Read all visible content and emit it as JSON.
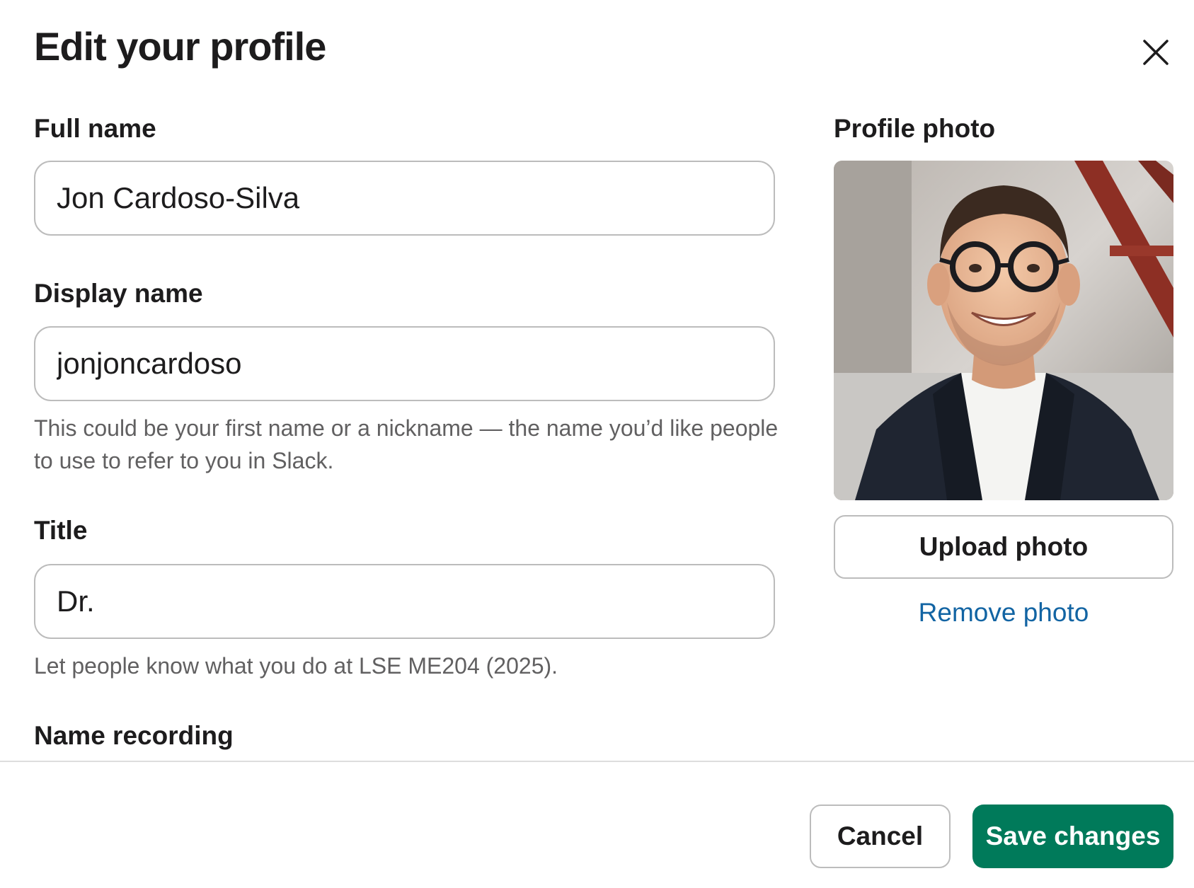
{
  "dialog": {
    "title": "Edit your profile",
    "close_icon": "close-icon"
  },
  "fields": {
    "full_name": {
      "label": "Full name",
      "value": "Jon Cardoso-Silva"
    },
    "display_name": {
      "label": "Display name",
      "value": "jonjoncardoso",
      "hint": "This could be your first name or a nickname — the name you’d like people to use to refer to you in Slack."
    },
    "title": {
      "label": "Title",
      "value": "Dr.",
      "hint": "Let people know what you do at LSE ME204 (2025)."
    },
    "name_recording": {
      "label": "Name recording"
    }
  },
  "profile_photo": {
    "label": "Profile photo",
    "upload_label": "Upload photo",
    "remove_label": "Remove photo"
  },
  "footer": {
    "cancel_label": "Cancel",
    "save_label": "Save changes"
  },
  "colors": {
    "primary": "#007a5a",
    "link": "#1264a3",
    "text": "#1d1c1d",
    "hint_text": "#616061",
    "border": "#bcbcbc"
  }
}
